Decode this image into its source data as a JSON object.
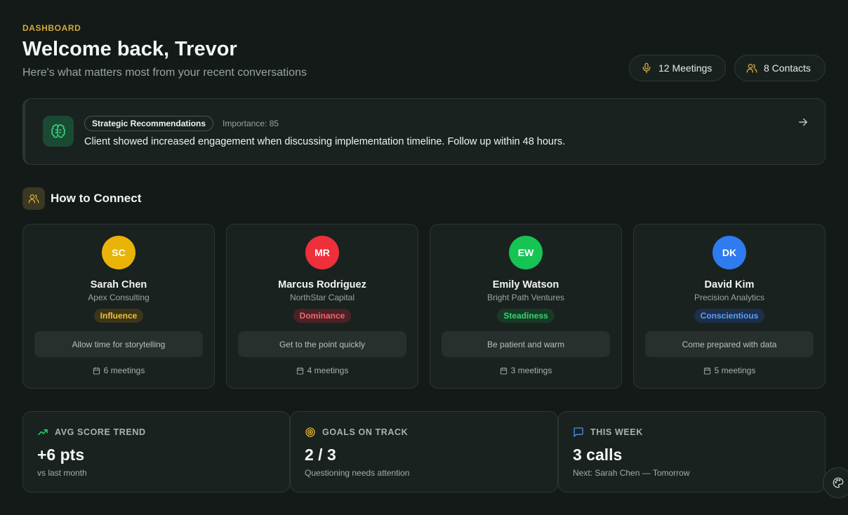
{
  "header": {
    "eyebrow": "DASHBOARD",
    "title": "Welcome back, Trevor",
    "subtitle": "Here's what matters most from your recent conversations",
    "meetings_pill": "12 Meetings",
    "contacts_pill": "8 Contacts"
  },
  "recommendation": {
    "tag": "Strategic Recommendations",
    "importance": "Importance: 85",
    "text": "Client showed increased engagement when discussing implementation timeline. Follow up within 48 hours."
  },
  "connect": {
    "title": "How to Connect",
    "contacts": [
      {
        "initials": "SC",
        "name": "Sarah Chen",
        "company": "Apex Consulting",
        "style": "Influence",
        "tip": "Allow time for storytelling",
        "meetings": "6 meetings",
        "avatar_color": "#eab308",
        "badge_bg": "#3b351a",
        "badge_fg": "#f1c232"
      },
      {
        "initials": "MR",
        "name": "Marcus Rodriguez",
        "company": "NorthStar Capital",
        "style": "Dominance",
        "tip": "Get to the point quickly",
        "meetings": "4 meetings",
        "avatar_color": "#ef2f3a",
        "badge_bg": "#4a2226",
        "badge_fg": "#f0676c"
      },
      {
        "initials": "EW",
        "name": "Emily Watson",
        "company": "Bright Path Ventures",
        "style": "Steadiness",
        "tip": "Be patient and warm",
        "meetings": "3 meetings",
        "avatar_color": "#16c454",
        "badge_bg": "#173a26",
        "badge_fg": "#36d46d"
      },
      {
        "initials": "DK",
        "name": "David Kim",
        "company": "Precision Analytics",
        "style": "Conscientious",
        "tip": "Come prepared with data",
        "meetings": "5 meetings",
        "avatar_color": "#2f7bf0",
        "badge_bg": "#1d2f4a",
        "badge_fg": "#5da0f5"
      }
    ]
  },
  "stats": {
    "trend": {
      "label": "AVG SCORE TREND",
      "value": "+6 pts",
      "sub": "vs last month"
    },
    "goals": {
      "label": "GOALS ON TRACK",
      "value": "2 / 3",
      "sub": "Questioning needs attention"
    },
    "week": {
      "label": "THIS WEEK",
      "value": "3 calls",
      "sub": "Next: Sarah Chen — Tomorrow"
    }
  },
  "icons": {
    "meetings": "microphone-icon",
    "contacts": "users-icon",
    "recommendation": "brain-icon",
    "arrow": "arrow-right-icon",
    "trend": "trending-up-icon",
    "goals": "target-icon",
    "week": "message-square-icon",
    "palette": "palette-icon"
  }
}
